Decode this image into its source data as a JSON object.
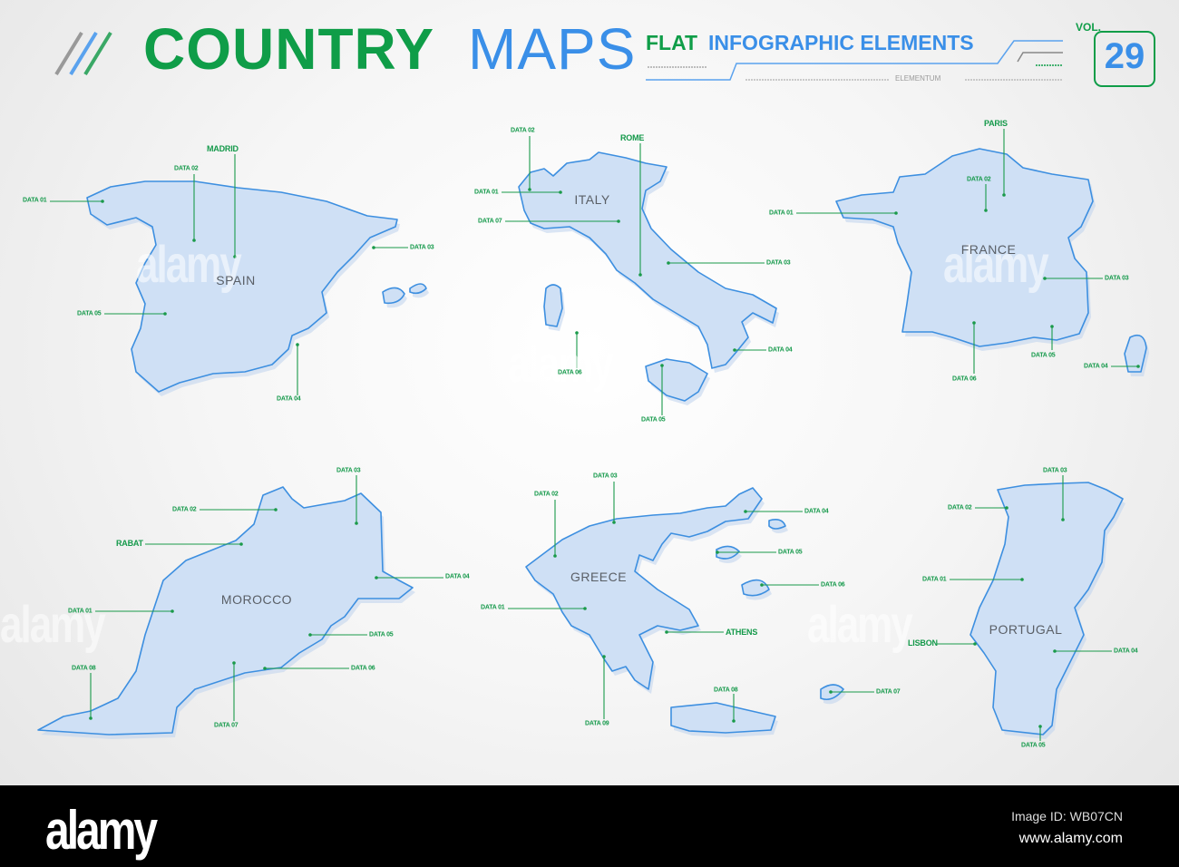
{
  "header": {
    "title_part1": "COUNTRY",
    "title_part2": "MAPS",
    "subtitle_flat": "FLAT",
    "subtitle_rest": "INFOGRAPHIC ELEMENTS",
    "brand": "ELEMENTUM",
    "vol_label": "VOL.",
    "vol_number": "29"
  },
  "colors": {
    "green": "#0f9d48",
    "blue": "#3a8fe8",
    "map_fill": "#cfe0f5",
    "map_stroke": "#3d8fe0"
  },
  "countries": [
    {
      "name": "SPAIN",
      "labels": [
        "DATA 01",
        "DATA 02",
        "MADRID",
        "DATA 03",
        "DATA 05",
        "DATA 04"
      ]
    },
    {
      "name": "ITALY",
      "labels": [
        "DATA 02",
        "ROME",
        "DATA 01",
        "DATA 07",
        "DATA 03",
        "DATA 06",
        "DATA 04",
        "DATA 05"
      ]
    },
    {
      "name": "FRANCE",
      "labels": [
        "PARIS",
        "DATA 02",
        "DATA 01",
        "DATA 03",
        "DATA 06",
        "DATA 05",
        "DATA 04"
      ]
    },
    {
      "name": "MOROCCO",
      "labels": [
        "DATA 03",
        "DATA 02",
        "RABAT",
        "DATA 04",
        "DATA 01",
        "DATA 05",
        "DATA 06",
        "DATA 08",
        "DATA 07"
      ]
    },
    {
      "name": "GREECE",
      "labels": [
        "DATA 03",
        "DATA 02",
        "DATA 04",
        "DATA 05",
        "DATA 06",
        "DATA 01",
        "ATHENS",
        "DATA 08",
        "DATA 07",
        "DATA 09"
      ]
    },
    {
      "name": "PORTUGAL",
      "labels": [
        "DATA 03",
        "DATA 02",
        "DATA 01",
        "LISBON",
        "DATA 04",
        "DATA 05"
      ]
    }
  ],
  "watermark": "alamy",
  "footer": {
    "logo": "alamy",
    "image_id": "Image ID: WB07CN",
    "url": "www.alamy.com"
  }
}
